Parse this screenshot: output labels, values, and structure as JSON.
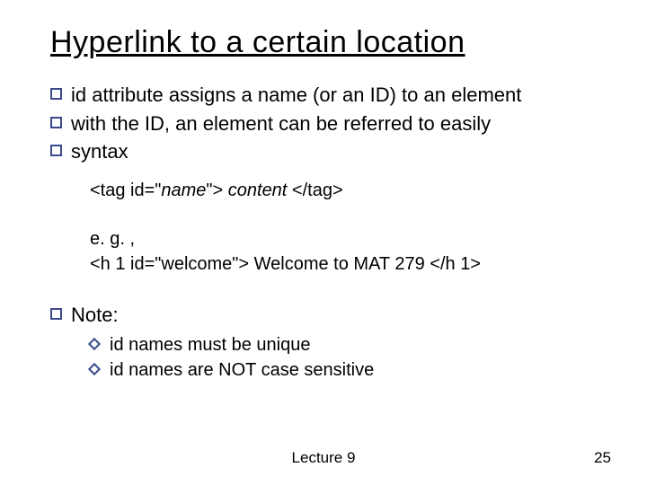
{
  "title": "Hyperlink to a certain location",
  "bullets": {
    "b1_pre": "id",
    "b1_post": " attribute assigns a name (or an ID) to an element",
    "b2": "with the ID, an element can be referred to easily",
    "b3": "syntax"
  },
  "syntax": {
    "open1": "<tag id=\"",
    "name": "name",
    "open2": "\">",
    "content": " content ",
    "close": "</tag>"
  },
  "example": {
    "eg": "e. g. ,",
    "line": "<h 1 id=\"welcome\"> Welcome to MAT 279 </h 1>"
  },
  "note": {
    "heading": "Note:",
    "n1": "id names must be unique",
    "n2": "id names are NOT case sensitive"
  },
  "footer": {
    "center": "Lecture 9",
    "page": "25"
  }
}
